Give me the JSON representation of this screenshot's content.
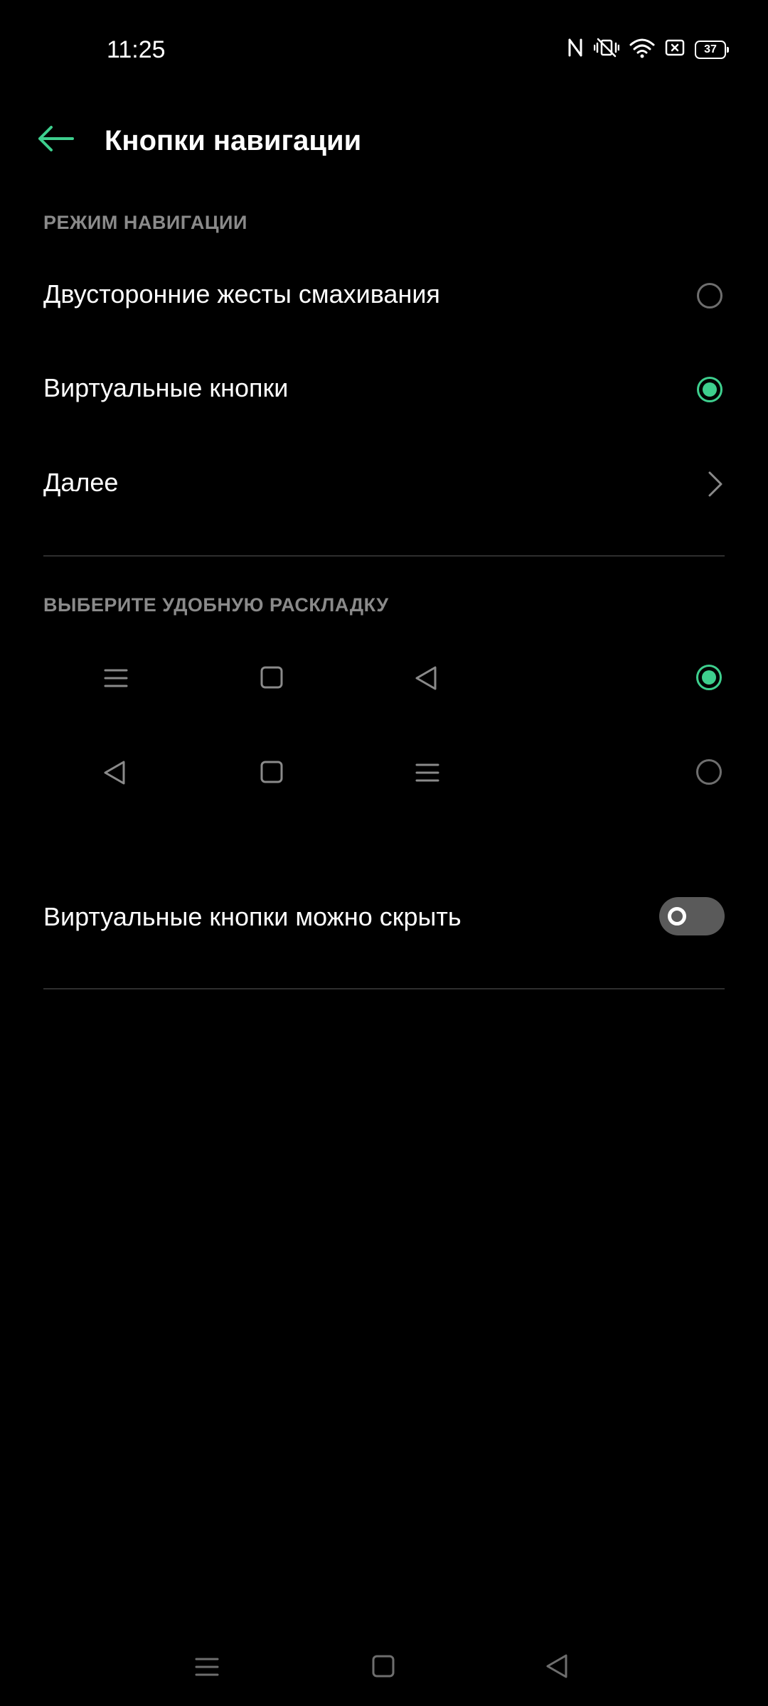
{
  "status_bar": {
    "time": "11:25",
    "battery": "37",
    "icons": [
      "nfc-icon",
      "vibrate-off-icon",
      "wifi-icon",
      "sim-icon",
      "battery-icon"
    ]
  },
  "header": {
    "title": "Кнопки навигации",
    "back_icon": "arrow-left-icon"
  },
  "navigation_mode": {
    "section_title": "РЕЖИМ НАВИГАЦИИ",
    "options": [
      {
        "label": "Двусторонние жесты смахивания",
        "selected": false
      },
      {
        "label": "Виртуальные кнопки",
        "selected": true
      }
    ],
    "more_label": "Далее"
  },
  "layout": {
    "section_title": "ВЫБЕРИТЕ УДОБНУЮ РАСКЛАДКУ",
    "options": [
      {
        "buttons": [
          "menu-icon",
          "home-square-icon",
          "back-triangle-icon"
        ],
        "selected": true
      },
      {
        "buttons": [
          "back-triangle-icon",
          "home-square-icon",
          "menu-icon"
        ],
        "selected": false
      }
    ]
  },
  "hide_buttons": {
    "label": "Виртуальные кнопки можно скрыть",
    "enabled": false
  },
  "system_nav_bar": {
    "buttons": [
      "menu-icon",
      "home-square-icon",
      "back-triangle-icon"
    ]
  },
  "colors": {
    "accent": "#3ecf8e",
    "background": "#000000",
    "section_text": "#8a8a8a"
  }
}
